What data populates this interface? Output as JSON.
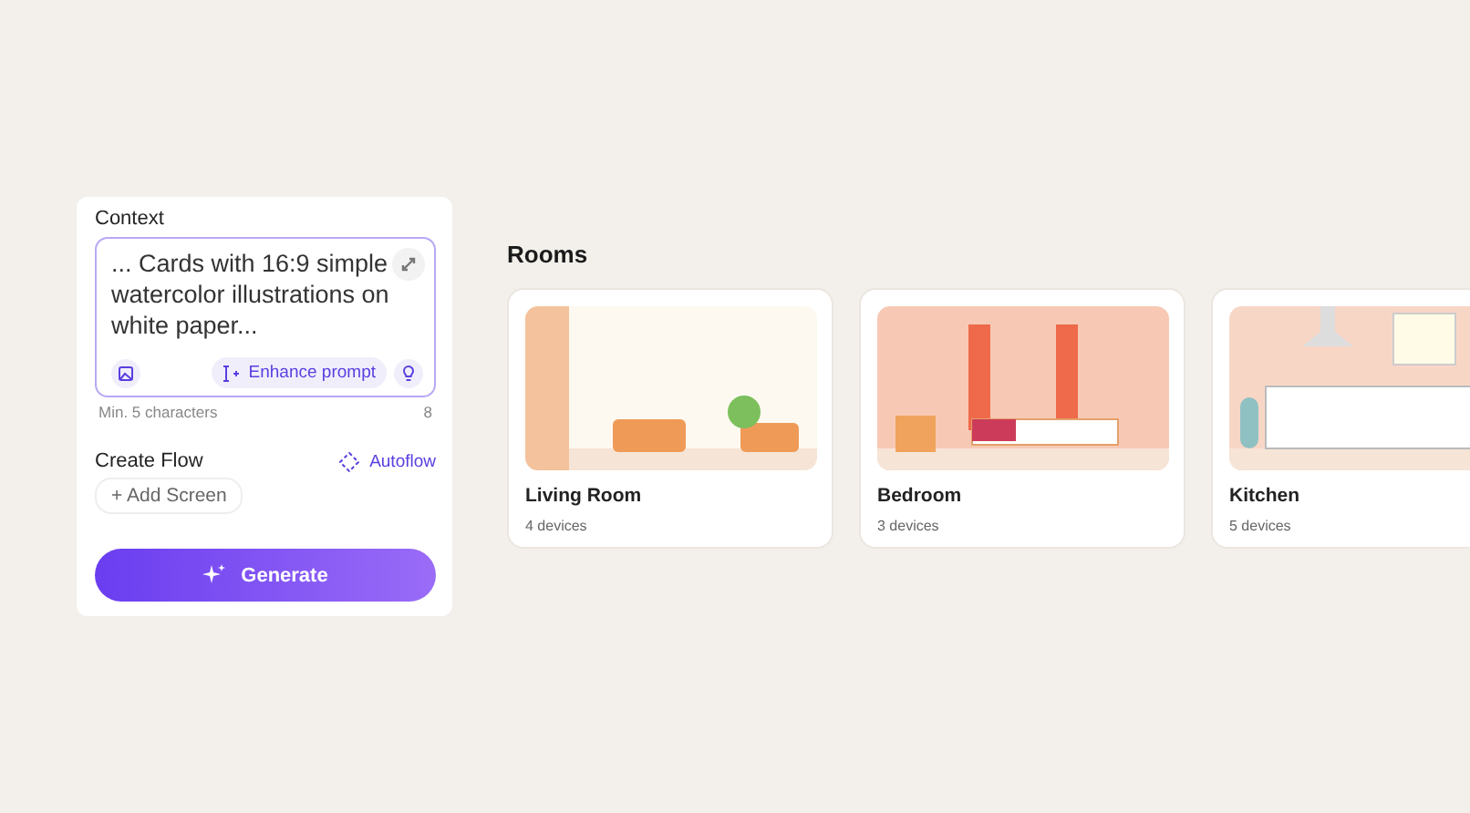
{
  "context_panel": {
    "title": "Context",
    "prompt": {
      "value": "... Cards with 16:9 simple watercolor illustrations on white paper...",
      "enhance_label": "Enhance prompt"
    },
    "hint": "Min. 5 characters",
    "count": "8",
    "flow_title": "Create Flow",
    "autoflow_label": "Autoflow",
    "add_screen_label": "+ Add Screen",
    "generate_label": "Generate"
  },
  "rooms": {
    "title": "Rooms",
    "cards": [
      {
        "name": "Living Room",
        "devices": "4 devices",
        "kind": "living"
      },
      {
        "name": "Bedroom",
        "devices": "3 devices",
        "kind": "bedroom"
      },
      {
        "name": "Kitchen",
        "devices": "5 devices",
        "kind": "kitchen"
      }
    ]
  }
}
